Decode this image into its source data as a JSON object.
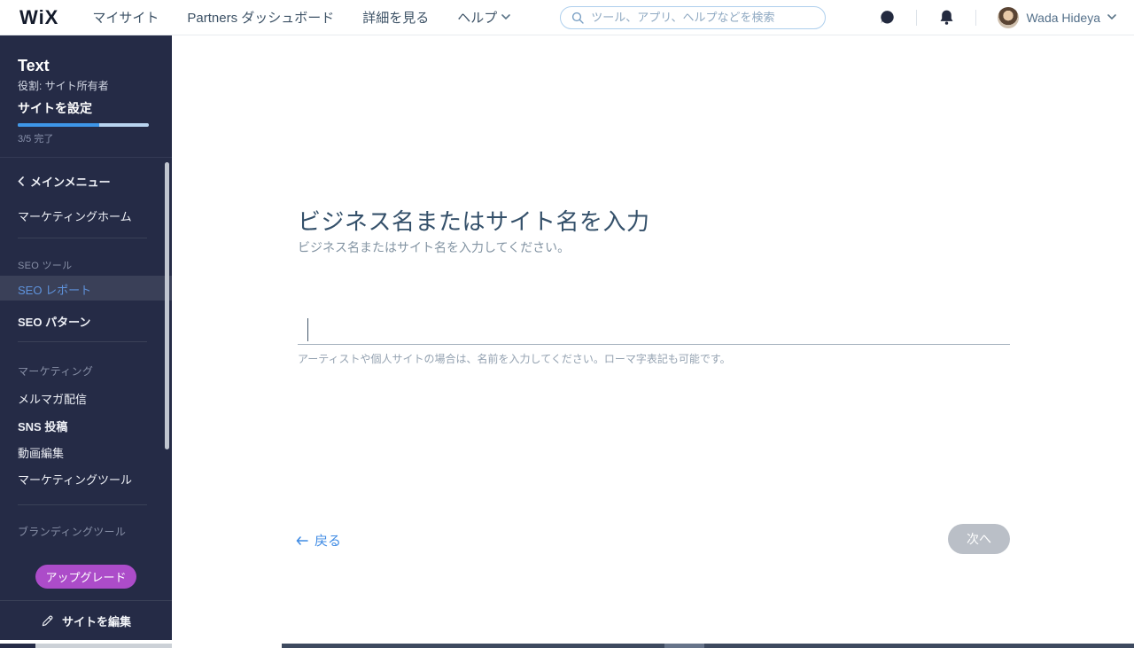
{
  "topbar": {
    "logo": "WiX",
    "nav": [
      {
        "label": "マイサイト"
      },
      {
        "label": "Partners ダッシュボード"
      },
      {
        "label": "詳細を見る"
      },
      {
        "label": "ヘルプ"
      }
    ],
    "search": {
      "placeholder": "ツール、アプリ、ヘルプなどを検索",
      "value": ""
    },
    "user": {
      "name": "Wada Hideya"
    }
  },
  "sidebar": {
    "profile": {
      "name": "Text",
      "role": "役割: サイト所有者",
      "setup_label": "サイトを設定",
      "progress_percent": 62,
      "progress_text": "3/5 完了"
    },
    "back_item_label": "メインメニュー",
    "items": [
      {
        "label": "マーケティングホーム",
        "type": "link"
      },
      {
        "label": "SEO ツール",
        "type": "section"
      },
      {
        "label": "SEO レポート",
        "type": "link",
        "active": true
      },
      {
        "label": "SEO パターン",
        "type": "link"
      },
      {
        "label": "マーケティング",
        "type": "section"
      },
      {
        "label": "メルマガ配信",
        "type": "link"
      },
      {
        "label": "SNS 投稿",
        "type": "link"
      },
      {
        "label": "動画編集",
        "type": "link"
      },
      {
        "label": "マーケティングツール",
        "type": "link"
      },
      {
        "label": "ブランディングツール",
        "type": "section"
      }
    ],
    "upgrade_label": "アップグレード",
    "edit_site_label": "サイトを編集"
  },
  "main": {
    "title": "ビジネス名またはサイト名を入力",
    "subtitle": "ビジネス名またはサイト名を入力してください。",
    "input": {
      "value": "",
      "helper": "アーティストや個人サイトの場合は、名前を入力してください。ローマ字表記も可能です。"
    },
    "back_label": "戻る",
    "next_label": "次へ"
  },
  "icons": {
    "search": "magnifier",
    "chat": "speech-bubble",
    "bell": "notification-bell",
    "chevron_down": "v",
    "chevron_left": "‹",
    "arrow_left": "←",
    "pencil": "edit-pen"
  },
  "colors": {
    "sidebar_bg": "#252b46",
    "sidebar_active_bg": "#3a4058",
    "sidebar_active_text": "#5f93dd",
    "progress_fill": "#3e96e8",
    "progress_track": "#b9d4ef",
    "upgrade_purple": "#ac4cc9",
    "link_blue": "#3f8be4",
    "heading": "#34506a",
    "disabled_button": "#babfc7",
    "search_border": "#aecfed"
  }
}
